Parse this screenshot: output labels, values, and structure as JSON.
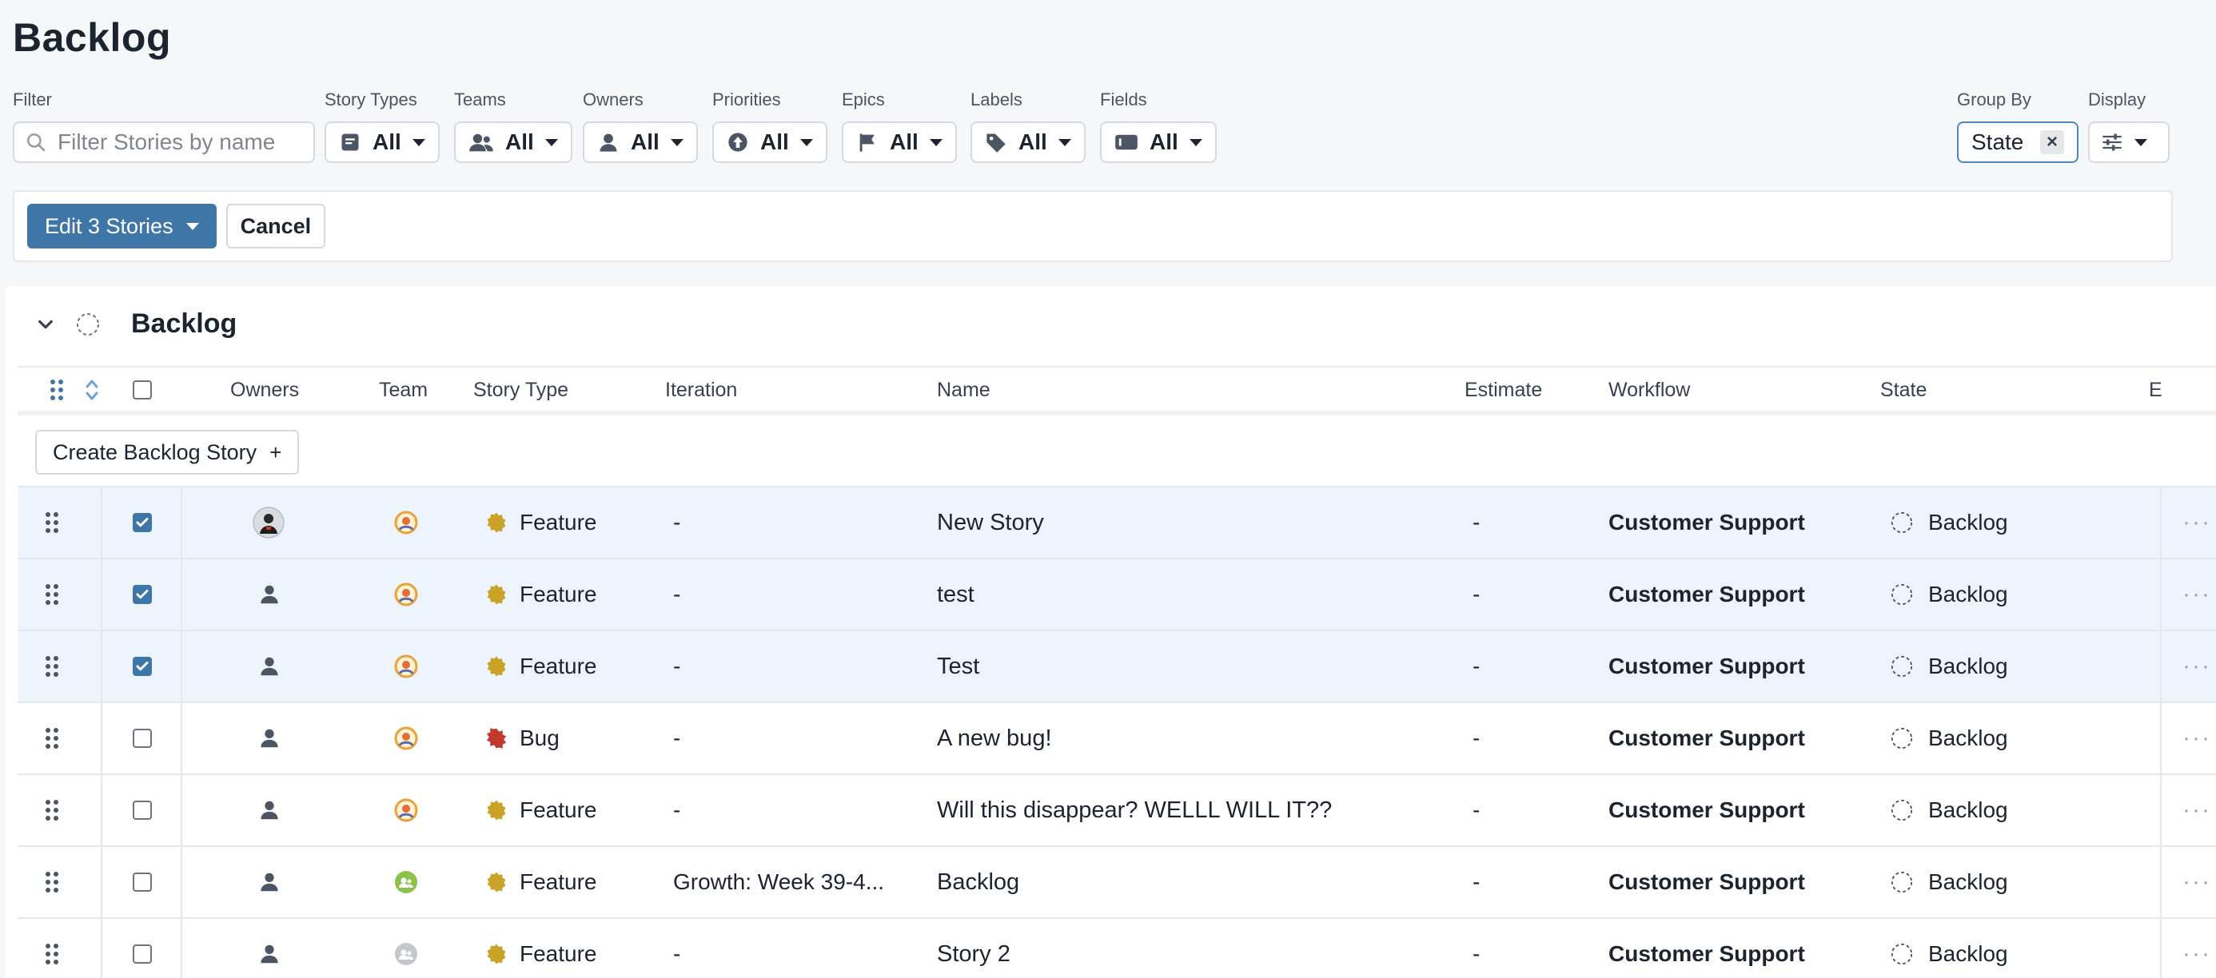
{
  "page_title": "Backlog",
  "filters": {
    "filter_label": "Filter",
    "search_placeholder": "Filter Stories by name",
    "story_types": {
      "label": "Story Types",
      "value": "All"
    },
    "teams": {
      "label": "Teams",
      "value": "All"
    },
    "owners": {
      "label": "Owners",
      "value": "All"
    },
    "priorities": {
      "label": "Priorities",
      "value": "All"
    },
    "epics": {
      "label": "Epics",
      "value": "All"
    },
    "labels": {
      "label": "Labels",
      "value": "All"
    },
    "fields": {
      "label": "Fields",
      "value": "All"
    },
    "group_by": {
      "label": "Group By",
      "value": "State"
    },
    "display": {
      "label": "Display"
    }
  },
  "bulk_bar": {
    "edit_label": "Edit 3 Stories",
    "cancel_label": "Cancel"
  },
  "group": {
    "title": "Backlog",
    "create_label": "Create Backlog Story"
  },
  "columns": {
    "owners": "Owners",
    "team": "Team",
    "story_type": "Story Type",
    "iteration": "Iteration",
    "name": "Name",
    "estimate": "Estimate",
    "workflow": "Workflow",
    "state": "State",
    "epic_short": "E"
  },
  "colors": {
    "accent": "#3e76a8",
    "feature": "#c9a227",
    "bug": "#c0392b",
    "selected_row": "#eef4fb"
  },
  "rows": [
    {
      "selected": true,
      "owner": "avatar-photo",
      "team": "team-orange-icon",
      "type": "Feature",
      "iteration": "-",
      "name": "New Story",
      "estimate": "-",
      "workflow": "Customer Support",
      "state": "Backlog"
    },
    {
      "selected": true,
      "owner": "person-icon",
      "team": "team-orange-icon",
      "type": "Feature",
      "iteration": "-",
      "name": "test",
      "estimate": "-",
      "workflow": "Customer Support",
      "state": "Backlog"
    },
    {
      "selected": true,
      "owner": "person-icon",
      "team": "team-orange-icon",
      "type": "Feature",
      "iteration": "-",
      "name": "Test",
      "estimate": "-",
      "workflow": "Customer Support",
      "state": "Backlog"
    },
    {
      "selected": false,
      "owner": "person-icon",
      "team": "team-orange-icon",
      "type": "Bug",
      "iteration": "-",
      "name": "A new bug!",
      "estimate": "-",
      "workflow": "Customer Support",
      "state": "Backlog"
    },
    {
      "selected": false,
      "owner": "person-icon",
      "team": "team-orange-icon",
      "type": "Feature",
      "iteration": "-",
      "name": "Will this disappear? WELLL WILL IT??",
      "estimate": "-",
      "workflow": "Customer Support",
      "state": "Backlog"
    },
    {
      "selected": false,
      "owner": "person-icon",
      "team": "team-green-icon",
      "type": "Feature",
      "iteration": "Growth: Week 39-4...",
      "name": "Backlog",
      "estimate": "-",
      "workflow": "Customer Support",
      "state": "Backlog"
    },
    {
      "selected": false,
      "owner": "person-icon",
      "team": "team-gray-icon",
      "type": "Feature",
      "iteration": "-",
      "name": "Story 2",
      "estimate": "-",
      "workflow": "Customer Support",
      "state": "Backlog"
    }
  ]
}
